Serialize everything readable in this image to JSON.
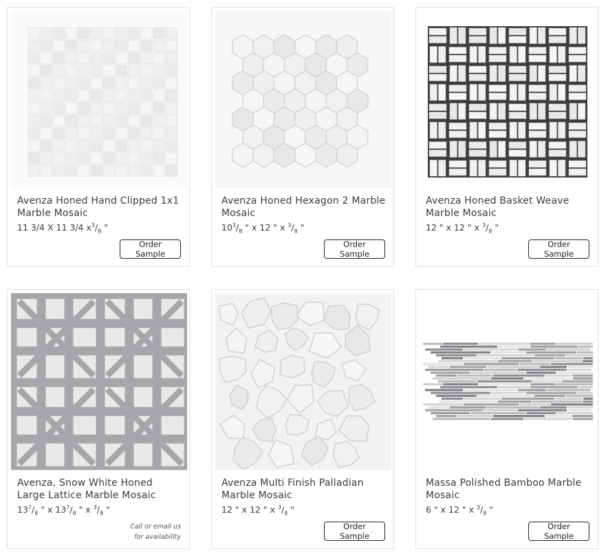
{
  "products": [
    {
      "title": "Avenza Honed Hand Clipped 1x1 Marble Mosaic",
      "dims": {
        "a": "11 3/4 X 11 3/4 x",
        "a_sup": "3",
        "a_sub": "8",
        "b": "\""
      },
      "action": "Order Sample",
      "image": "square-1x1-mosaic-tile"
    },
    {
      "title": "Avenza Honed Hexagon 2 Marble Mosaic",
      "dims": {
        "lead": "10",
        "l_sup": "3",
        "l_sub": "8",
        "mid": "\" x 12 \" x",
        "m_sup": "3",
        "m_sub": "8",
        "end": "\""
      },
      "action": "Order Sample",
      "image": "hexagon-mosaic-tile"
    },
    {
      "title": "Avenza Honed Basket Weave Marble Mosaic",
      "dims": {
        "mid": "12 \" x 12 \" x",
        "m_sup": "3",
        "m_sub": "8",
        "end": "\""
      },
      "action": "Order Sample",
      "image": "basket-weave-mosaic-tile"
    },
    {
      "title": "Avenza, Snow White Honed Large Lattice Marble Mosaic",
      "dims": {
        "lead": "13",
        "l_sup": "7",
        "l_sub": "8",
        "mid": "\" x 13",
        "mid_sup": "7",
        "mid_sub": "8",
        "mid2": "\" x",
        "m_sup": "3",
        "m_sub": "8",
        "end": "\""
      },
      "availability_line1": "Call or email us",
      "availability_line2": "for availability",
      "image": "lattice-mosaic-tile"
    },
    {
      "title": "Avenza Multi Finish Palladian Marble Mosaic",
      "dims": {
        "mid": "12 \" x 12 \" x",
        "m_sup": "3",
        "m_sub": "8",
        "end": "\""
      },
      "action": "Order Sample",
      "image": "palladian-mosaic-tile"
    },
    {
      "title": "Massa Polished Bamboo Marble Mosaic",
      "dims": {
        "mid": "6 \" x 12 \" x",
        "m_sup": "3",
        "m_sub": "8",
        "end": "\""
      },
      "action": "Order Sample",
      "image": "bamboo-strip-mosaic-tile"
    }
  ],
  "colors": {
    "tile_light": "#f1f1f1",
    "grout": "#e4e4e4",
    "gray_stone": "#9a9c9f",
    "border": "#e1e1e1"
  }
}
